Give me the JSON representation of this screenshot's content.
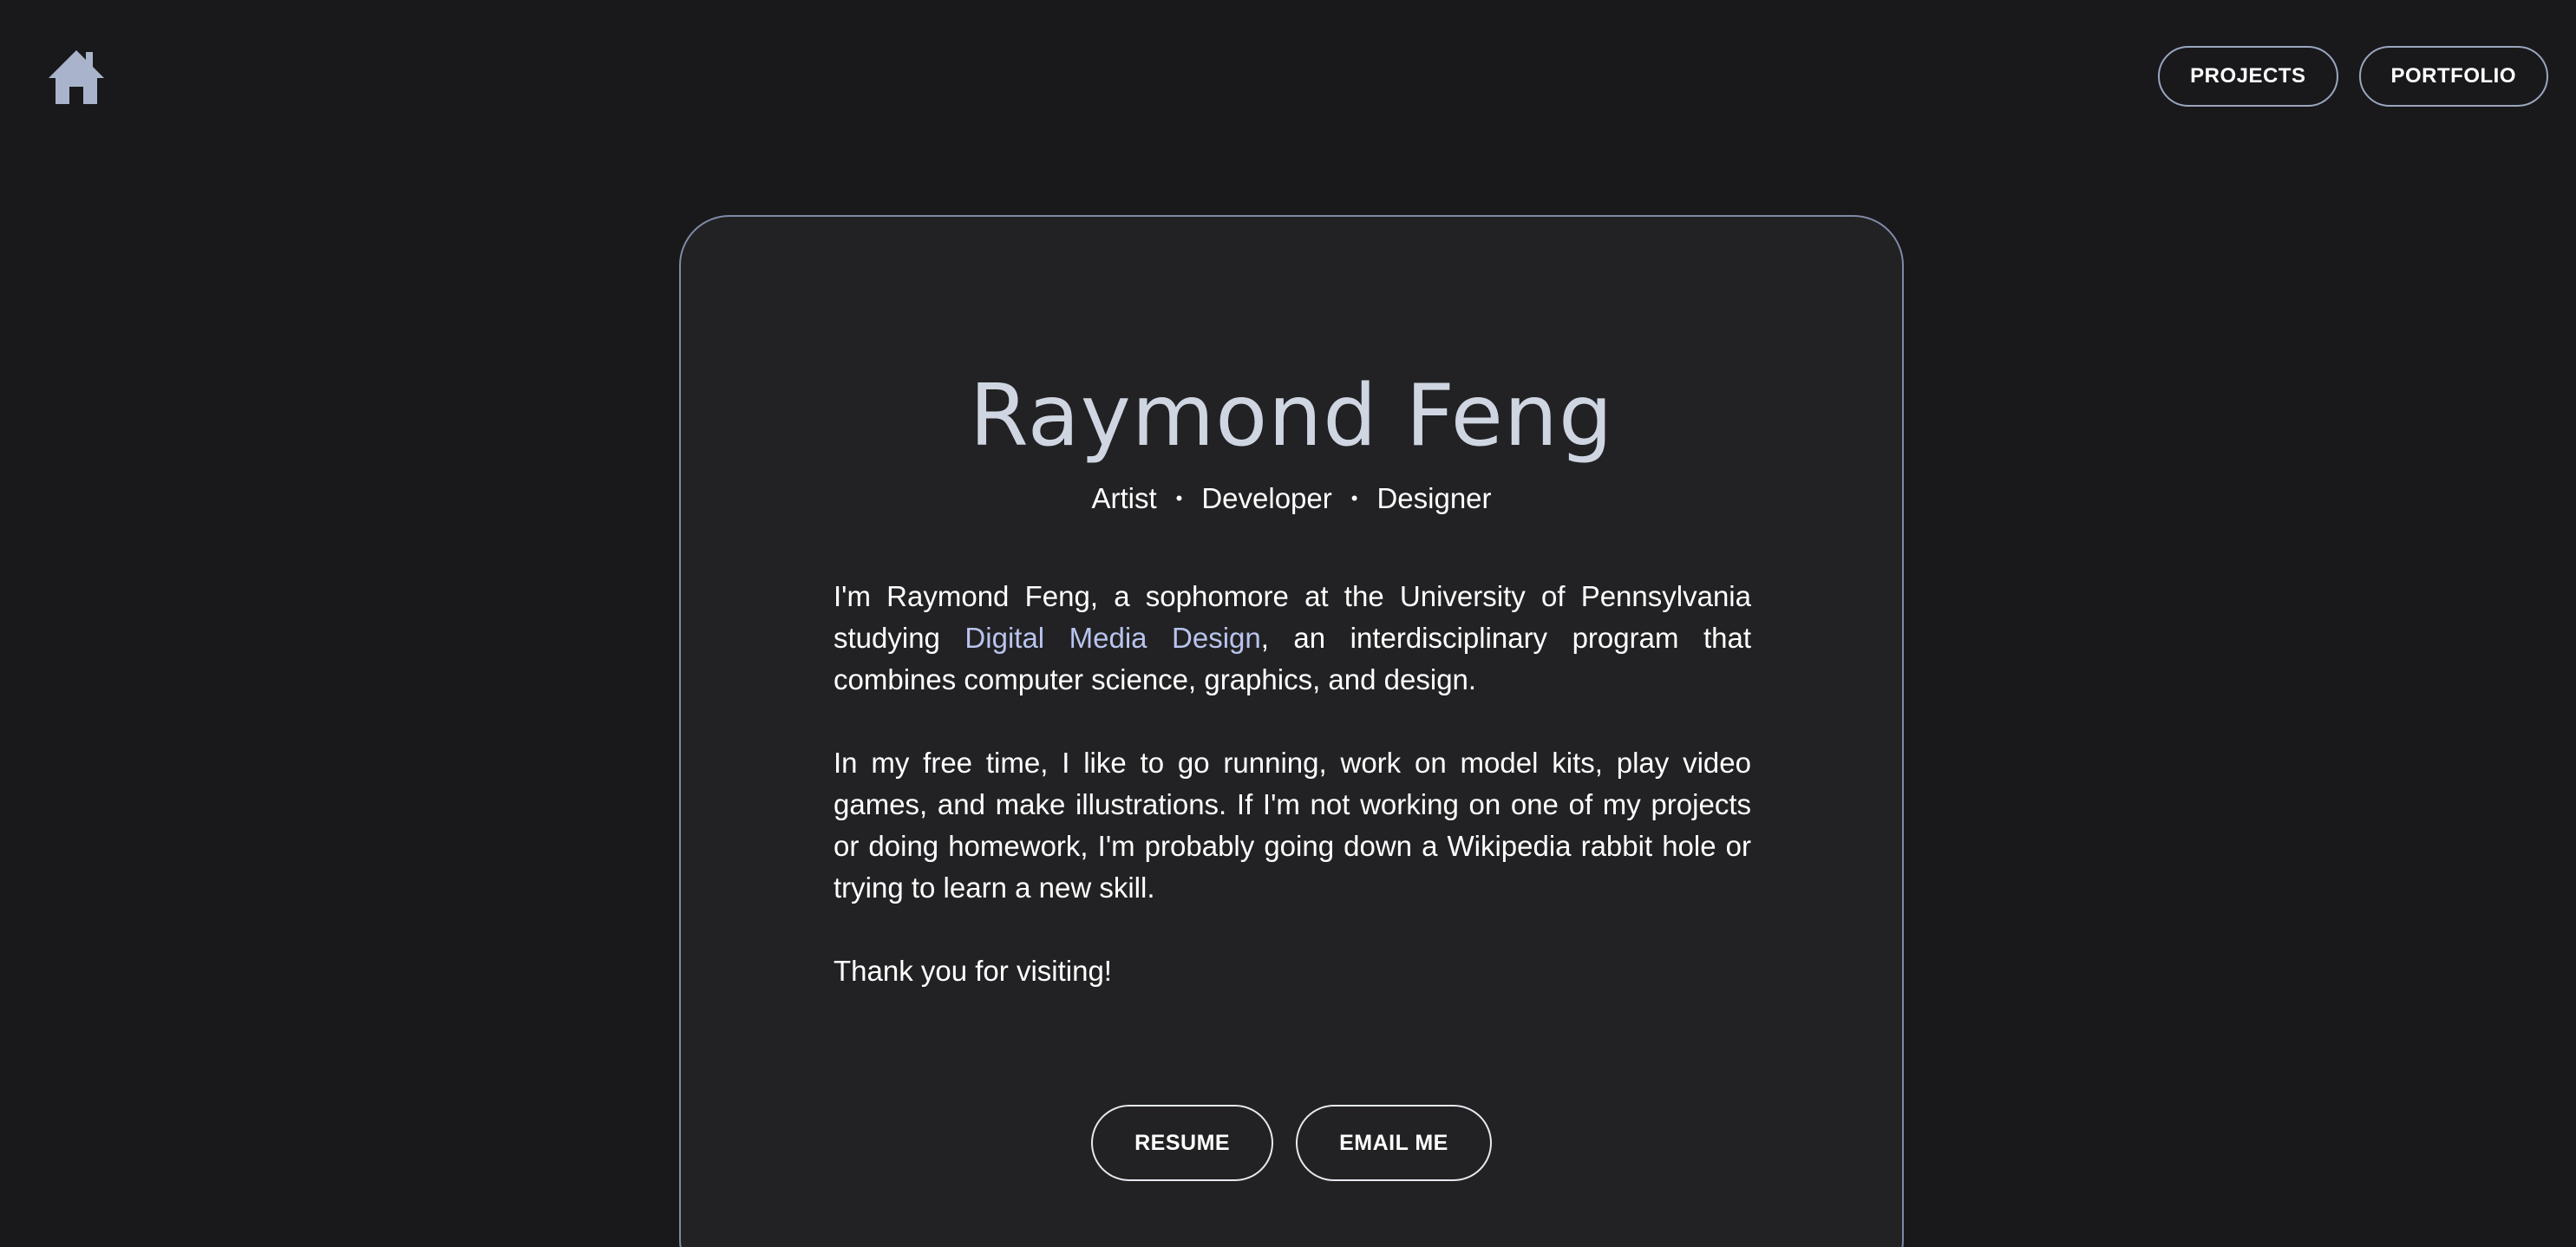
{
  "header": {
    "home_icon": "home-icon",
    "nav": [
      {
        "label": "PROJECTS"
      },
      {
        "label": "PORTFOLIO"
      }
    ]
  },
  "profile": {
    "name": "Raymond Feng",
    "roles": [
      "Artist",
      "Developer",
      "Designer"
    ],
    "separator": "•",
    "bio": {
      "p1_before": "I'm Raymond Feng, a sophomore at the University of Pennsylvania studying ",
      "p1_link": "Digital Media Design",
      "p1_after": ", an interdisciplinary program that combines computer science, graphics, and design.",
      "p2": "In my free time, I like to go running, work on model kits, play video games, and make illustrations. If I'm not working on one of my projects or doing homework, I'm probably going down a Wikipedia rabbit hole or trying to learn a new skill.",
      "p3": "Thank you for visiting!"
    },
    "buttons": {
      "resume": "RESUME",
      "email": "EMAIL ME"
    }
  },
  "colors": {
    "background": "#19191b",
    "card": "#222224",
    "accent": "#9aa6bf",
    "link": "#b9c4ee",
    "name": "#cfd6e2"
  }
}
